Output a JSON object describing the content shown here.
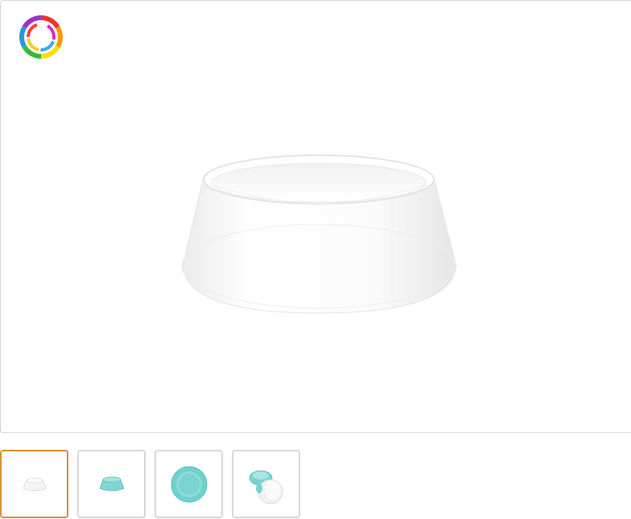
{
  "logo": {
    "icon": "rainbow-swirl-logo-icon"
  },
  "main_image": {
    "icon": "white-pet-bowl-image",
    "color": "#ffffff"
  },
  "thumbnails": [
    {
      "icon": "white-bowl-thumb-icon",
      "color": "#f2f2f2",
      "selected": true
    },
    {
      "icon": "teal-bowl-thumb-icon",
      "color": "#7fd6d3",
      "selected": false
    },
    {
      "icon": "teal-bowl-top-view-icon",
      "color": "#6fd1cf",
      "selected": false
    },
    {
      "icon": "teal-white-bowl-stack-icon",
      "color": "#79d2cf",
      "selected": false
    }
  ],
  "colors": {
    "selected_border": "#d9913a",
    "thumb_border": "#d8d8d8",
    "viewer_border": "#d5d5d5"
  }
}
